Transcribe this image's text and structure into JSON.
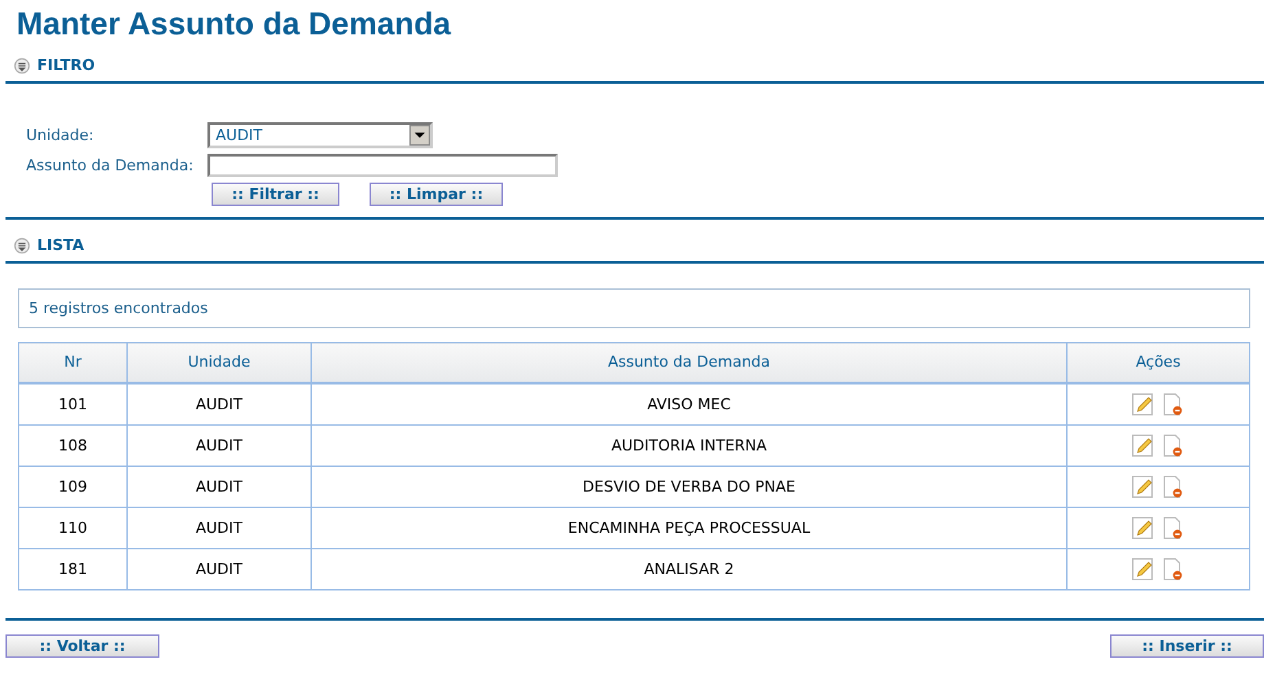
{
  "title": "Manter Assunto da Demanda",
  "filter_section": {
    "title": "FILTRO"
  },
  "filter": {
    "unit_label": "Unidade:",
    "unit_value": "AUDIT",
    "subject_label": "Assunto da Demanda:",
    "buttons": [
      ":: Filtrar ::",
      ":: Limpar ::"
    ]
  },
  "list_section": {
    "title": "LISTA"
  },
  "record_count": "5 registros encontrados",
  "table": {
    "columns": [
      "Nr",
      "Unidade",
      "Assunto da Demanda",
      "Ações"
    ],
    "rows": [
      {
        "nr": "101",
        "unit": "AUDIT",
        "subject": "AVISO MEC"
      },
      {
        "nr": "108",
        "unit": "AUDIT",
        "subject": "AUDITORIA INTERNA"
      },
      {
        "nr": "109",
        "unit": "AUDIT",
        "subject": "DESVIO DE VERBA DO PNAE"
      },
      {
        "nr": "110",
        "unit": "AUDIT",
        "subject": "ENCAMINHA PEÇA PROCESSUAL"
      },
      {
        "nr": "181",
        "unit": "AUDIT",
        "subject": "ANALISAR 2"
      }
    ]
  },
  "footer_buttons": [
    ":: Voltar ::",
    ":: Inserir ::"
  ]
}
